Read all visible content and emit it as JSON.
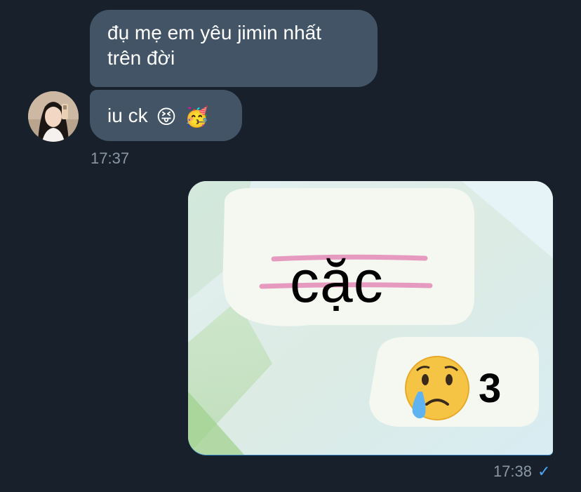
{
  "messages": [
    {
      "text_line1": "đụ mẹ em yêu jimin nhất",
      "text_line2": "trên đời"
    },
    {
      "text": "iu ck",
      "emojis": [
        "😝",
        "🥳"
      ]
    }
  ],
  "incoming_time": "17:37",
  "image_message": {
    "word": "cặc",
    "reaction_emoji": "😢",
    "reaction_count": "3",
    "icon": "sticker-image"
  },
  "outgoing_time": "17:38",
  "status_icon": "checkmark-icon",
  "colors": {
    "background": "#17202b",
    "incoming_bubble": "#425466",
    "timestamp": "#8a97a4",
    "check": "#4aa6f0"
  }
}
